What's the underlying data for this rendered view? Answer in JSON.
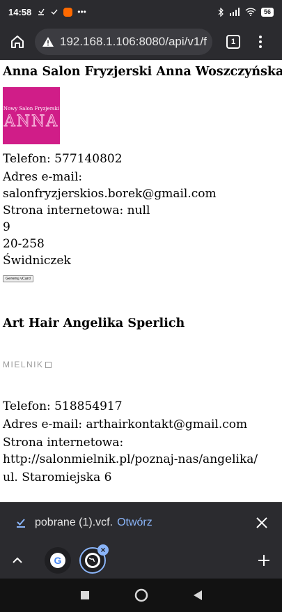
{
  "status_bar": {
    "time": "14:58",
    "battery": "56"
  },
  "browser": {
    "url": "192.168.1.106:8080/api/v1/f",
    "tab_count": "1"
  },
  "businesses": [
    {
      "name": "Anna Salon Fryzjerski Anna Woszczyńska",
      "logo_text_top": "Nowy Salon Fryzjerski",
      "logo_text_big": "ANNA",
      "lines": [
        "Telefon: 577140802",
        "Adres e-mail:",
        "salonfryzjerskios.borek@gmail.com",
        "Strona internetowa: null",
        "9",
        "20-258",
        "Świdniczek"
      ],
      "vcard_button": "Generuj vCard"
    },
    {
      "name": "Art Hair Angelika Sperlich",
      "logo_text": "MIELNIK",
      "lines": [
        "Telefon: 518854917",
        "Adres e-mail: arthairkontakt@gmail.com",
        "Strona internetowa:",
        "http://salonmielnik.pl/poznaj-nas/angelika/",
        "ul. Staromiejska 6"
      ]
    }
  ],
  "download_bar": {
    "filename": "pobrane (1).vcf.",
    "open_label": "Otwórz"
  },
  "tab_strip": {
    "google_letter": "G"
  },
  "colors": {
    "chrome_dark": "#2b2b2f",
    "link_blue": "#8ab4f8",
    "logo_magenta": "#d01d88"
  }
}
